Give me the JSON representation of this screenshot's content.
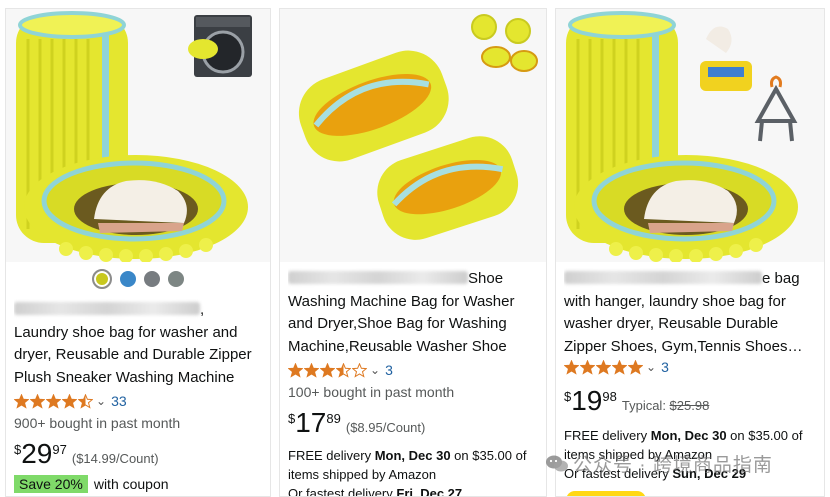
{
  "colors": {
    "accent_yellow": "#e4e62f",
    "coupon_green": "#7fda69",
    "link_blue": "#2162a1",
    "star_orange": "#de7921"
  },
  "products": [
    {
      "title_tail": ", Laundry shoe bag for washer and dryer, Reusable and Durable Zipper Plush Sneaker Washing Machine Bag for…",
      "swatches": [
        "#c8c81e",
        "#3a87c8",
        "#777c80",
        "#7d8684"
      ],
      "rating": 4.5,
      "rating_count": "33",
      "bought": "900+ bought in past month",
      "price_symbol": "$",
      "price_whole": "29",
      "price_fraction": "97",
      "unit_price": "($14.99/Count)",
      "coupon_badge": "Save 20%",
      "coupon_text": "with coupon"
    },
    {
      "title_tail": "Shoe Washing Machine Bag for Washer and Dryer,Shoe Bag for Washing Machine,Reusable Washer Shoe Ba…",
      "rating": 3.5,
      "rating_count": "3",
      "bought": "100+ bought in past month",
      "price_symbol": "$",
      "price_whole": "17",
      "price_fraction": "89",
      "unit_price": "($8.95/Count)",
      "delivery_prefix": "FREE delivery ",
      "delivery_date": "Mon, Dec 30",
      "delivery_suffix": " on $35.00 of items shipped by Amazon",
      "fastest_prefix": "Or fastest delivery ",
      "fastest_date": "Fri, Dec 27"
    },
    {
      "title_tail": "e bag with hanger, laundry shoe bag for washer dryer, Reusable Durable Zipper Shoes, Gym,Tennis Shoes…",
      "rating": 5,
      "rating_count": "3",
      "price_symbol": "$",
      "price_whole": "19",
      "price_fraction": "98",
      "typical_label": "Typical: ",
      "typical_price": "$25.98",
      "delivery_prefix": "FREE delivery ",
      "delivery_date": "Mon, Dec 30",
      "delivery_suffix": " on $35.00 of items shipped by Amazon",
      "fastest_prefix": "Or fastest delivery ",
      "fastest_date": "Sun, Dec 29"
    }
  ],
  "watermark": {
    "text": "公众号 · 跨境商品指南",
    "icon": "wechat-icon"
  }
}
